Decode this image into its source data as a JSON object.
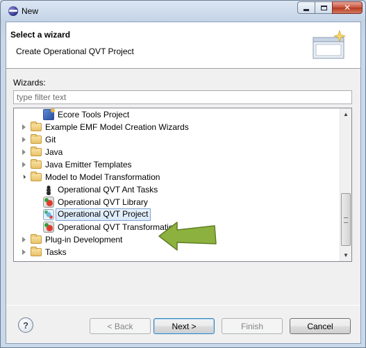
{
  "window": {
    "title": "New"
  },
  "header": {
    "title": "Select a wizard",
    "description": "Create Operational QVT Project"
  },
  "wizards_label": "Wizards:",
  "filter": {
    "placeholder": "type filter text",
    "value": ""
  },
  "tree": {
    "items": [
      {
        "label": "Ecore Tools Project",
        "icon": "ecore-tools-icon",
        "state": "leaf",
        "level": 1
      },
      {
        "label": "Example EMF Model Creation Wizards",
        "icon": "folder-icon",
        "state": "collapsed",
        "level": 0
      },
      {
        "label": "Git",
        "icon": "folder-icon",
        "state": "collapsed",
        "level": 0
      },
      {
        "label": "Java",
        "icon": "folder-icon",
        "state": "collapsed",
        "level": 0
      },
      {
        "label": "Java Emitter Templates",
        "icon": "folder-icon",
        "state": "collapsed",
        "level": 0
      },
      {
        "label": "Model to Model Transformation",
        "icon": "folder-icon",
        "state": "expanded",
        "level": 0
      },
      {
        "label": "Operational QVT Ant Tasks",
        "icon": "ant-icon",
        "state": "leaf",
        "level": 1
      },
      {
        "label": "Operational QVT Library",
        "icon": "qvt-library-icon",
        "state": "leaf",
        "level": 1
      },
      {
        "label": "Operational QVT Project",
        "icon": "qvt-project-icon",
        "state": "leaf",
        "level": 1,
        "selected": true
      },
      {
        "label": "Operational QVT Transformation",
        "icon": "qvt-transformation-icon",
        "state": "leaf",
        "level": 1
      },
      {
        "label": "Plug-in Development",
        "icon": "folder-icon",
        "state": "collapsed",
        "level": 0
      },
      {
        "label": "Tasks",
        "icon": "folder-icon",
        "state": "collapsed",
        "level": 0
      }
    ]
  },
  "buttons": {
    "help": "?",
    "back": "< Back",
    "next": "Next >",
    "finish": "Finish",
    "cancel": "Cancel"
  },
  "colors": {
    "annotation_arrow": "#8db13e",
    "selection_border": "#7da2ce"
  }
}
